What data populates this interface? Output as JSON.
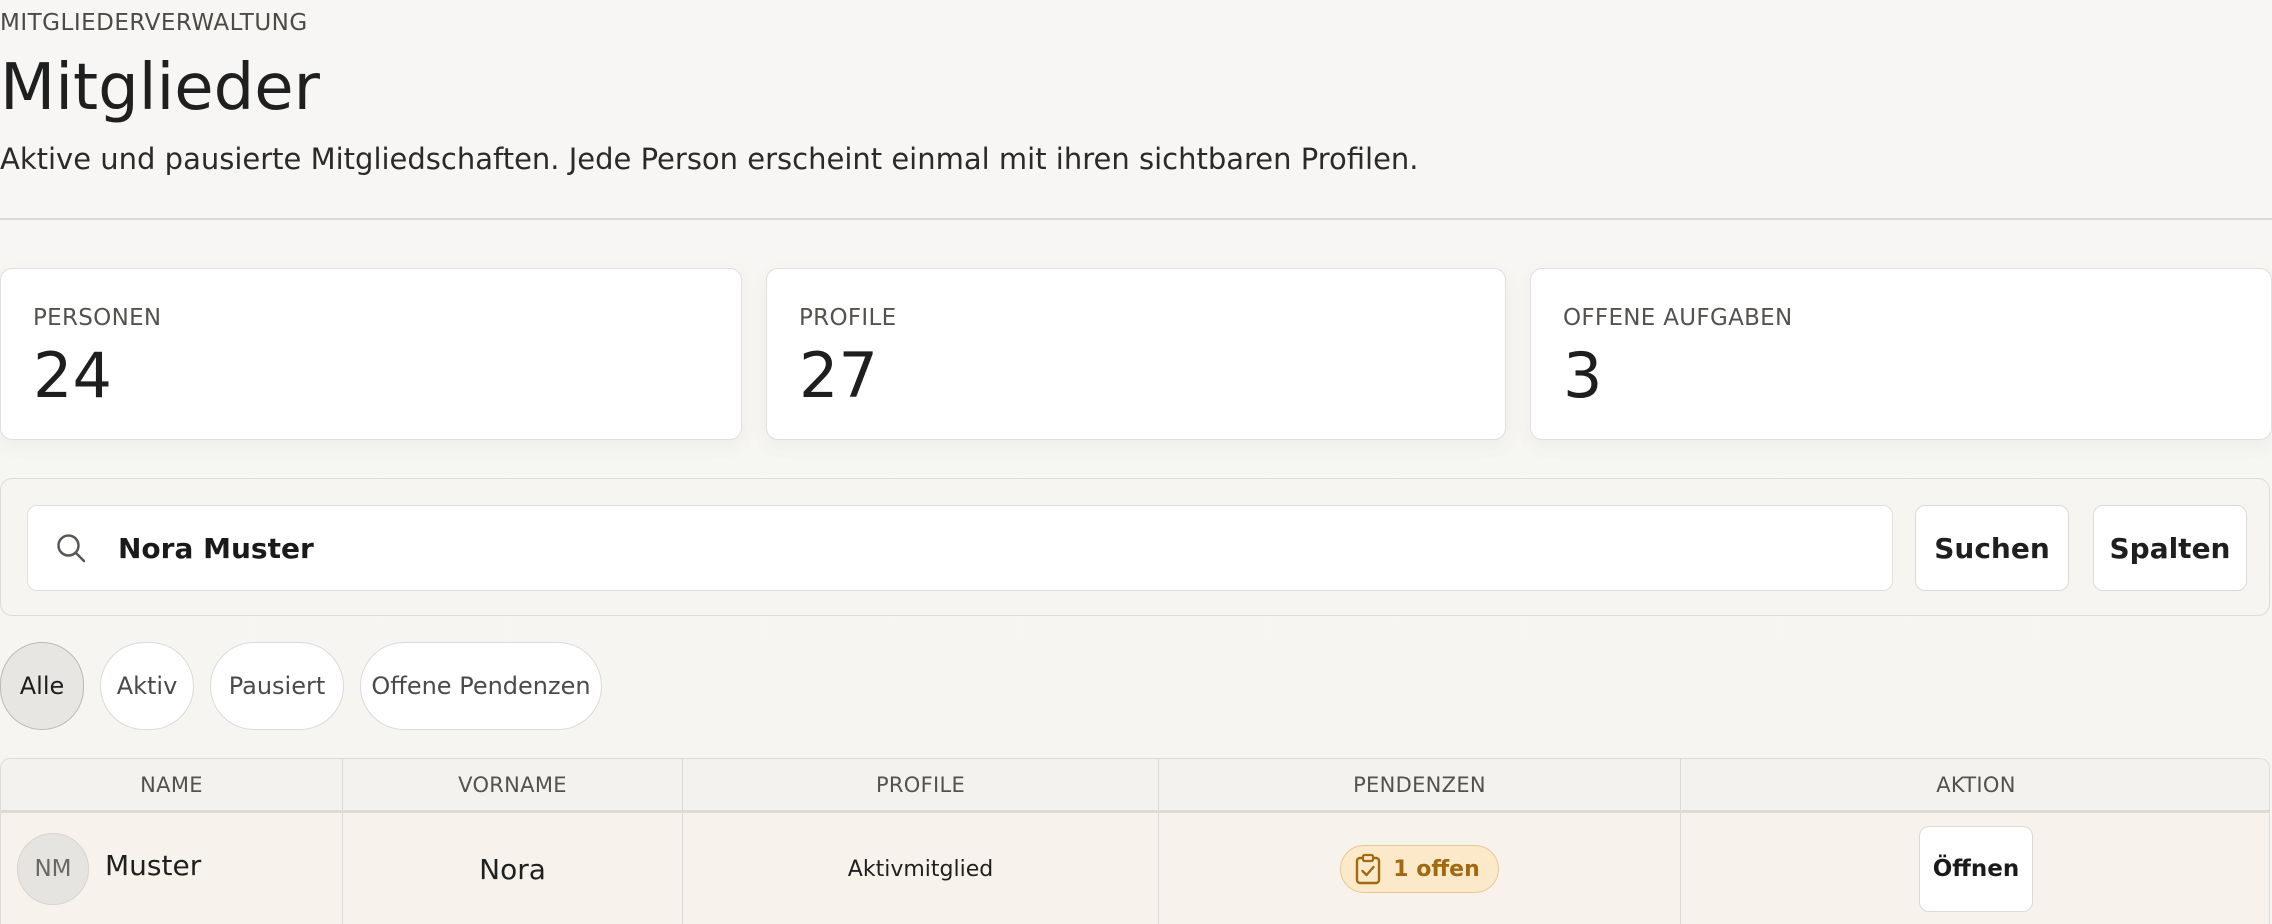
{
  "header": {
    "eyebrow": "MITGLIEDERVERWALTUNG",
    "title": "Mitglieder",
    "subtitle": "Aktive und pausierte Mitgliedschaften. Jede Person erscheint einmal mit ihren sichtbaren Profilen."
  },
  "stats": [
    {
      "label": "PERSONEN",
      "value": "24"
    },
    {
      "label": "PROFILE",
      "value": "27"
    },
    {
      "label": "OFFENE AUFGABEN",
      "value": "3"
    }
  ],
  "search": {
    "value": "Nora Muster",
    "icon": "search-icon",
    "search_button": "Suchen",
    "columns_button": "Spalten"
  },
  "filters": {
    "chips": [
      {
        "label": "Alle",
        "active": true
      },
      {
        "label": "Aktiv",
        "active": false
      },
      {
        "label": "Pausiert",
        "active": false
      },
      {
        "label": "Offene Pendenzen",
        "active": false
      }
    ]
  },
  "table": {
    "headers": [
      "NAME",
      "VORNAME",
      "PROFILE",
      "PENDENZEN",
      "AKTION"
    ],
    "rows": [
      {
        "initials": "NM",
        "name": "Muster",
        "firstname": "Nora",
        "profile": "Aktivmitglied",
        "pending": "1 offen",
        "action": "Öffnen"
      }
    ]
  },
  "colors": {
    "background": "#f6f5f2",
    "card": "#ffffff",
    "border": "#dcdad6",
    "pending_bg": "#fbe9c9",
    "pending_text": "#a16a10",
    "row_highlight": "#f7f3ec"
  }
}
